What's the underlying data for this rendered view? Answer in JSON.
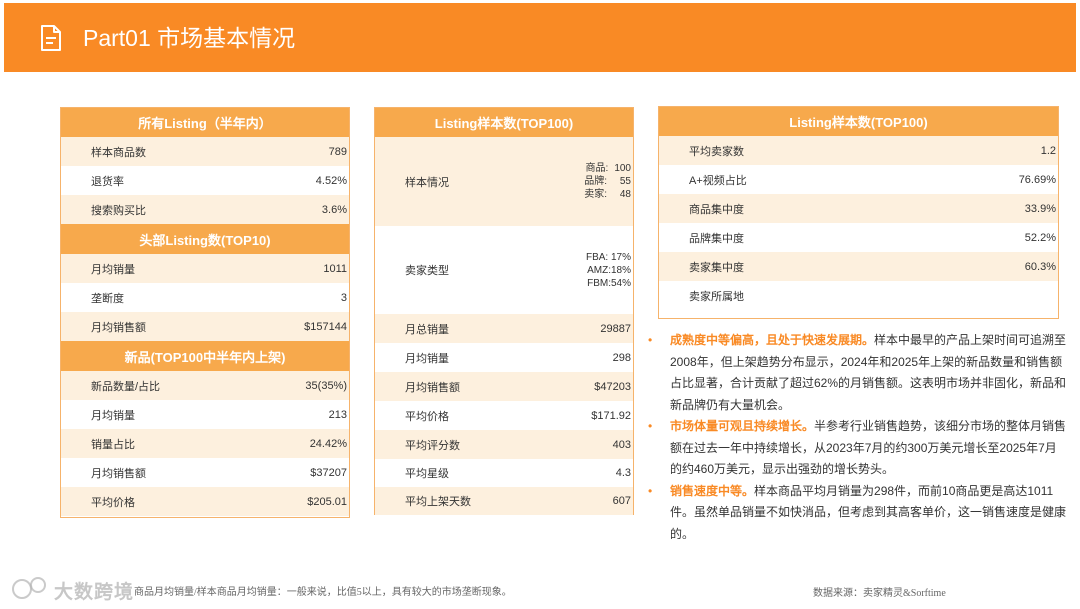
{
  "header": {
    "title": "Part01 市场基本情况",
    "icon": "document-icon",
    "color": "#f98a25"
  },
  "panel1": {
    "sec1_title": "所有Listing（半年内）",
    "sec1_rows": [
      {
        "label": "样本商品数",
        "value": "789"
      },
      {
        "label": "退货率",
        "value": "4.52%"
      },
      {
        "label": "搜索购买比",
        "value": "3.6%"
      }
    ],
    "sec2_title": "头部Listing数(TOP10)",
    "sec2_rows": [
      {
        "label": "月均销量",
        "value": "1011"
      },
      {
        "label": "垄断度",
        "value": "3"
      },
      {
        "label": "月均销售额",
        "value": "$157144"
      }
    ],
    "sec3_title": "新品(TOP100中半年内上架)",
    "sec3_rows": [
      {
        "label": "新品数量/占比",
        "value": "35(35%)"
      },
      {
        "label": "月均销量",
        "value": "213"
      },
      {
        "label": "销量占比",
        "value": "24.42%"
      },
      {
        "label": "月均销售额",
        "value": "$37207"
      },
      {
        "label": "平均价格",
        "value": "$205.01"
      }
    ]
  },
  "panel2": {
    "title": "Listing样本数(TOP100)",
    "sample_label": "样本情况",
    "sample_lines": [
      {
        "k": "商品:",
        "v": "100"
      },
      {
        "k": "品牌:",
        "v": "55"
      },
      {
        "k": "卖家:",
        "v": "48"
      }
    ],
    "seller_type_label": "卖家类型",
    "seller_type_lines": [
      "FBA: 17%",
      "AMZ:18%",
      "FBM:54%"
    ],
    "rows": [
      {
        "label": "月总销量",
        "value": "29887"
      },
      {
        "label": "月均销量",
        "value": "298"
      },
      {
        "label": "月均销售额",
        "value": "$47203"
      },
      {
        "label": "平均价格",
        "value": "$171.92"
      },
      {
        "label": "平均评分数",
        "value": "403"
      },
      {
        "label": "平均星级",
        "value": "4.3"
      },
      {
        "label": "平均上架天数",
        "value": "607"
      }
    ]
  },
  "panel3": {
    "title": "Listing样本数(TOP100)",
    "rows": [
      {
        "label": "平均卖家数",
        "value": "1.2"
      },
      {
        "label": "A+视频占比",
        "value": "76.69%"
      },
      {
        "label": "商品集中度",
        "value": "33.9%"
      },
      {
        "label": "品牌集中度",
        "value": "52.2%"
      },
      {
        "label": "卖家集中度",
        "value": "60.3%"
      },
      {
        "label": "卖家所属地",
        "value": ""
      }
    ]
  },
  "bullets": [
    {
      "highlight": "成熟度中等偏高，且处于快速发展期。",
      "text": "样本中最早的产品上架时间可追溯至2008年，但上架趋势分布显示，2024年和2025年上架的新品数量和销售额占比显著，合计贡献了超过62%的月销售额。这表明市场并非固化，新品和新品牌仍有大量机会。"
    },
    {
      "highlight": "市场体量可观且持续增长。",
      "text": "半参考行业销售趋势，该细分市场的整体月销售额在过去一年中持续增长，从2023年7月的约300万美元增长至2025年7月的约460万美元，显示出强劲的增长势头。"
    },
    {
      "highlight": "销售速度中等。",
      "text": "样本商品平均月销量为298件，而前10商品更是高达1011件。虽然单品销量不如快消品，但考虑到其高客单价，这一销售速度是健康的。"
    }
  ],
  "footnote": "商品月均销量/样本商品月均销量：一般来说，比值5以上，具有较大的市场垄断现象。",
  "source": "数据来源：卖家精灵&Sorftime",
  "watermark": "大数跨境"
}
